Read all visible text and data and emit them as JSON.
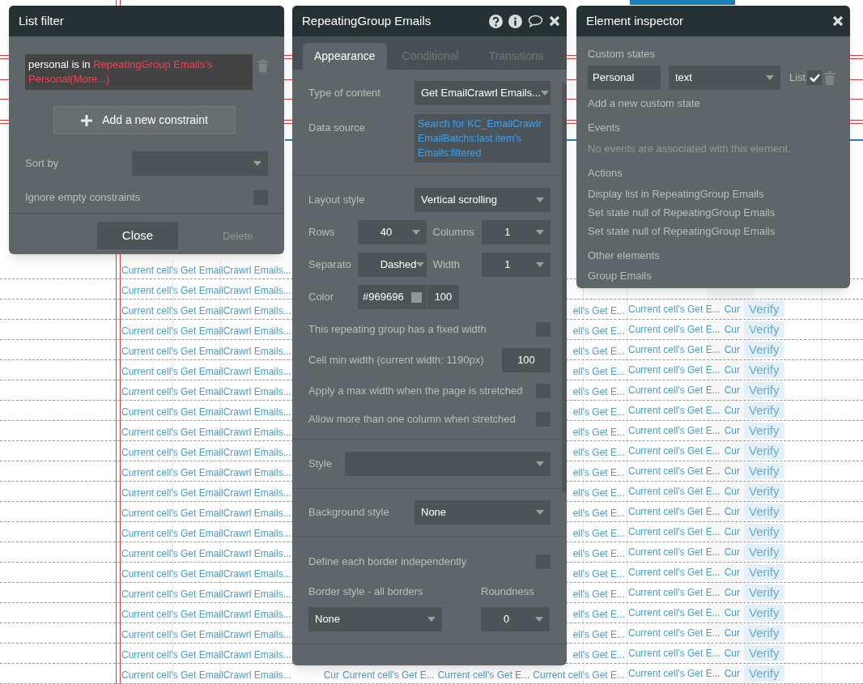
{
  "canvas": {
    "rows": [
      {
        "left": "Current cell's Get EmailCrawrl Emails..."
      },
      {
        "left": "Current cell's Get EmailCrawrl Emails..."
      },
      {
        "left": "Current cell's Get EmailCrawrl Emails...",
        "middle": [
          "ell's Get E..."
        ],
        "right": [
          "Current cell's Get E...",
          "Cur"
        ],
        "button": "Verify"
      },
      {
        "left": "Current cell's Get EmailCrawrl Emails...",
        "middle": [
          "ell's Get E..."
        ],
        "right": [
          "Current cell's Get E...",
          "Cur"
        ],
        "button": "Verify"
      },
      {
        "left": "Current cell's Get EmailCrawrl Emails...",
        "middle": [
          "ell's Get E..."
        ],
        "right": [
          "Current cell's Get E...",
          "Cur"
        ],
        "button": "Verify"
      },
      {
        "left": "Current cell's Get EmailCrawrl Emails...",
        "middle": [
          "ell's Get E..."
        ],
        "right": [
          "Current cell's Get E...",
          "Cur"
        ],
        "button": "Verify"
      },
      {
        "left": "Current cell's Get EmailCrawrl Emails...",
        "middle": [
          "ell's Get E..."
        ],
        "right": [
          "Current cell's Get E...",
          "Cur"
        ],
        "button": "Verify"
      },
      {
        "left": "Current cell's Get EmailCrawrl Emails...",
        "middle": [
          "ell's Get E..."
        ],
        "right": [
          "Current cell's Get E...",
          "Cur"
        ],
        "button": "Verify"
      },
      {
        "left": "Current cell's Get EmailCrawrl Emails...",
        "middle": [
          "ell's Get E..."
        ],
        "right": [
          "Current cell's Get E...",
          "Cur"
        ],
        "button": "Verify"
      },
      {
        "left": "Current cell's Get EmailCrawrl Emails...",
        "middle": [
          "ell's Get E..."
        ],
        "right": [
          "Current cell's Get E...",
          "Cur"
        ],
        "button": "Verify"
      },
      {
        "left": "Current cell's Get EmailCrawrl Emails...",
        "middle": [
          "ell's Get E..."
        ],
        "right": [
          "Current cell's Get E...",
          "Cur"
        ],
        "button": "Verify"
      },
      {
        "left": "Current cell's Get EmailCrawrl Emails...",
        "middle": [
          "ell's Get E..."
        ],
        "right": [
          "Current cell's Get E...",
          "Cur"
        ],
        "button": "Verify"
      },
      {
        "left": "Current cell's Get EmailCrawrl Emails...",
        "middle": [
          "ell's Get E..."
        ],
        "right": [
          "Current cell's Get E...",
          "Cur"
        ],
        "button": "Verify"
      },
      {
        "left": "Current cell's Get EmailCrawrl Emails...",
        "middle": [
          "ell's Get E..."
        ],
        "right": [
          "Current cell's Get E...",
          "Cur"
        ],
        "button": "Verify"
      },
      {
        "left": "Current cell's Get EmailCrawrl Emails...",
        "middle": [
          "ell's Get E..."
        ],
        "right": [
          "Current cell's Get E...",
          "Cur"
        ],
        "button": "Verify"
      },
      {
        "left": "Current cell's Get EmailCrawrl Emails...",
        "middle": [
          "ell's Get E..."
        ],
        "right": [
          "Current cell's Get E...",
          "Cur"
        ],
        "button": "Verify"
      },
      {
        "left": "Current cell's Get EmailCrawrl Emails...",
        "middle": [
          "ell's Get E..."
        ],
        "right": [
          "Current cell's Get E...",
          "Cur"
        ],
        "button": "Verify"
      },
      {
        "left": "Current cell's Get EmailCrawrl Emails...",
        "middle": [
          "ell's Get E..."
        ],
        "right": [
          "Current cell's Get E...",
          "Cur"
        ],
        "button": "Verify"
      },
      {
        "left": "Current cell's Get EmailCrawrl Emails...",
        "middle": [
          "ell's Get E..."
        ],
        "right": [
          "Current cell's Get E...",
          "Cur"
        ],
        "button": "Verify"
      },
      {
        "left": "Current cell's Get EmailCrawrl Emails...",
        "middle": [
          "ell's Get E..."
        ],
        "right": [
          "Current cell's Get E...",
          "Cur"
        ],
        "button": "Verify"
      },
      {
        "left": "Current cell's Get EmailCrawrl Emails...",
        "middle": [
          "Cur",
          "Current cell's Get E...",
          "Current cell's Get E...",
          "Current cell's Get E..."
        ],
        "right": [
          "Current cell's Get E...",
          "Cur"
        ],
        "button": "Verify"
      }
    ]
  },
  "list_filter": {
    "title": "List filter",
    "constraint": {
      "text": "personal is in",
      "expression": "RepeatingGroup Emails's Personal(More...)"
    },
    "add_button": "Add a new constraint",
    "sort_by": {
      "label": "Sort by"
    },
    "ignore_empty": {
      "label": "Ignore empty constraints",
      "checked": false
    },
    "buttons": [
      {
        "label": "Close",
        "disabled": false
      },
      {
        "label": "Delete",
        "disabled": true
      }
    ]
  },
  "editor": {
    "title": "RepeatingGroup Emails",
    "tabs": [
      {
        "label": "Appearance",
        "selected": true
      },
      {
        "label": "Conditional",
        "selected": false
      },
      {
        "label": "Transitions",
        "selected": false
      }
    ],
    "type_of_content": {
      "label": "Type of content",
      "value": "Get EmailCrawrl Emails..."
    },
    "data_source": {
      "label": "Data source",
      "value": "Search for KC_EmailCrawlr EmailBatchs:last item's Emails:filtered"
    },
    "layout_style": {
      "label": "Layout style",
      "value": "Vertical scrolling"
    },
    "rows": {
      "label": "Rows",
      "value": "40"
    },
    "columns": {
      "label": "Columns",
      "value": "1"
    },
    "separator": {
      "label": "Separato",
      "value": "Dashed"
    },
    "width": {
      "label": "Width",
      "value": "1"
    },
    "color": {
      "label": "Color",
      "value": "#969696",
      "opacity": "100"
    },
    "options": [
      {
        "kind": "checkbox",
        "label": "This repeating group has a fixed width",
        "checked": false
      },
      {
        "kind": "number",
        "label": "Cell min width (current width: 1190px)",
        "value": "100"
      },
      {
        "kind": "checkbox",
        "label": "Apply a max width when the page is stretched",
        "checked": false
      },
      {
        "kind": "checkbox",
        "label": "Allow more than one column when stretched",
        "checked": false
      }
    ],
    "style": {
      "label": "Style"
    },
    "background_style": {
      "label": "Background style",
      "value": "None"
    },
    "border_independent": {
      "label": "Define each border independently",
      "checked": false
    },
    "border_style": {
      "label": "Border style - all borders",
      "value": "None"
    },
    "roundness": {
      "label": "Roundness",
      "value": "0"
    }
  },
  "inspector": {
    "title": "Element inspector",
    "custom_states_label": "Custom states",
    "state": {
      "name": "Personal",
      "type": "text",
      "list_label": "List",
      "list": true
    },
    "add_state": "Add a new custom state",
    "events_label": "Events",
    "events_empty": "No events are associated with this element.",
    "actions_label": "Actions",
    "actions": [
      "Display list in RepeatingGroup Emails",
      "Set state null of RepeatingGroup Emails",
      "Set state null of RepeatingGroup Emails"
    ],
    "other_label": "Other elements",
    "others": [
      "Group Emails"
    ]
  }
}
